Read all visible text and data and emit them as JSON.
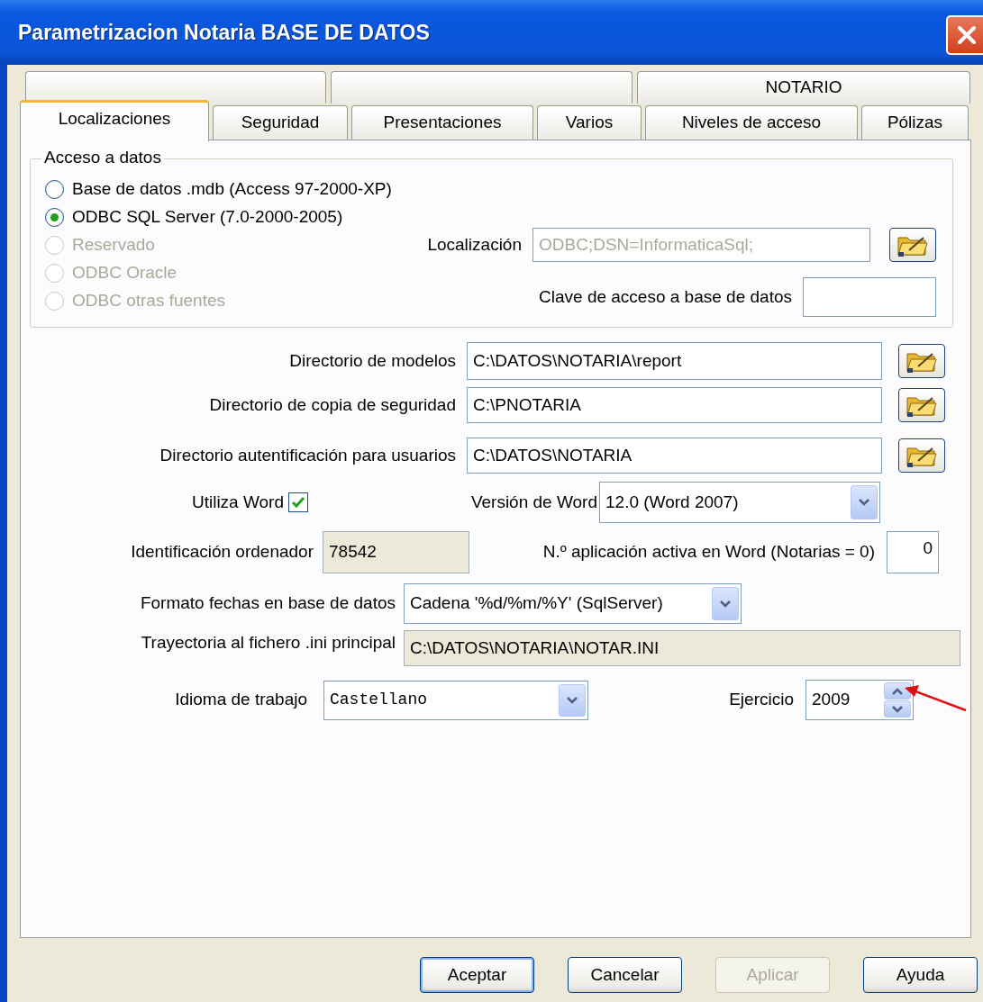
{
  "window": {
    "title": "Parametrizacion Notaria BASE DE DATOS"
  },
  "tab_rows": [
    {
      "tabs": [
        {
          "selected": false
        },
        {
          "selected": false
        },
        {
          "label": "NOTARIO",
          "selected": false
        }
      ]
    },
    {
      "tabs": [
        {
          "label": "Localizaciones",
          "selected": true
        },
        {
          "label": "Seguridad",
          "selected": false
        },
        {
          "label": "Presentaciones",
          "selected": false
        },
        {
          "label": "Varios",
          "selected": false
        },
        {
          "label": "Niveles de acceso",
          "selected": false
        },
        {
          "label": "Pólizas",
          "selected": false
        }
      ]
    }
  ],
  "data_access": {
    "title": "Acceso a datos",
    "options": [
      {
        "label": "Base de datos .mdb (Access 97-2000-XP)",
        "selected": false,
        "disabled": false
      },
      {
        "label": "ODBC SQL Server (7.0-2000-2005)",
        "selected": true,
        "disabled": false
      },
      {
        "label": "Reservado",
        "selected": false,
        "disabled": true
      },
      {
        "label": "ODBC Oracle",
        "selected": false,
        "disabled": true
      },
      {
        "label": "ODBC otras fuentes",
        "selected": false,
        "disabled": true
      }
    ],
    "location": {
      "label": "Localización",
      "value": "ODBC;DSN=InformaticaSql;",
      "disabled": true
    },
    "password": {
      "label": "Clave de acceso a base de datos"
    }
  },
  "directories": [
    {
      "label": "Directorio de modelos",
      "value": "C:\\DATOS\\NOTARIA\\report"
    },
    {
      "label": "Directorio de copia de seguridad",
      "value": "C:\\PNOTARIA"
    },
    {
      "label": "Directorio autentificación para usuarios",
      "value": "C:\\DATOS\\NOTARIA"
    }
  ],
  "use_word": {
    "label": "Utiliza Word",
    "checked": true
  },
  "word_version": {
    "label": "Versión de Word",
    "value": "12.0 (Word 2007)"
  },
  "computer_id": {
    "label": "Identificación ordenador",
    "value": "78542",
    "read_only": true
  },
  "word_app_number": {
    "label": "N.º aplicación activa en Word (Notarias = 0)",
    "value": "0"
  },
  "date_format": {
    "label": "Formato fechas en base de datos",
    "value": "Cadena '%d/%m/%Y' (SqlServer)"
  },
  "ini_path": {
    "label": "Trayectoria al fichero .ini principal",
    "value": "C:\\DATOS\\NOTARIA\\NOTAR.INI",
    "read_only": true
  },
  "language": {
    "label": "Idioma de trabajo",
    "value": "Castellano"
  },
  "year": {
    "label": "Ejercicio",
    "value": "2009"
  },
  "buttons": [
    {
      "label": "Aceptar",
      "disabled": false,
      "default": true
    },
    {
      "label": "Cancelar",
      "disabled": false,
      "default": false
    },
    {
      "label": "Aplicar",
      "disabled": true,
      "default": false
    },
    {
      "label": "Ayuda",
      "disabled": false,
      "default": false
    }
  ]
}
